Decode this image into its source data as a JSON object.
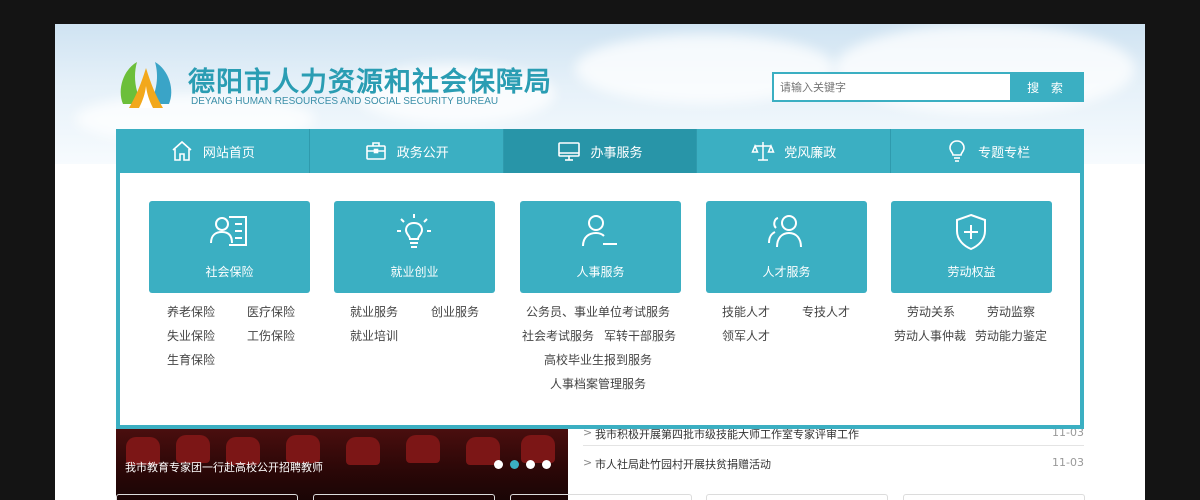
{
  "header": {
    "title_cn": "德阳市人力资源和社会保障局",
    "title_en": "DEYANG HUMAN RESOURCES AND SOCIAL SECURITY BUREAU",
    "logo_icon": "bureau-logo-icon"
  },
  "search": {
    "placeholder": "请输入关键字",
    "button_label": "搜 索"
  },
  "nav": {
    "items": [
      {
        "label": "网站首页",
        "icon": "home-icon"
      },
      {
        "label": "政务公开",
        "icon": "briefcase-icon"
      },
      {
        "label": "办事服务",
        "icon": "monitor-icon",
        "active": true
      },
      {
        "label": "党风廉政",
        "icon": "scales-icon"
      },
      {
        "label": "专题专栏",
        "icon": "lightbulb-icon"
      }
    ]
  },
  "services": [
    {
      "title": "社会保险",
      "icon": "id-card-icon",
      "links": [
        "养老保险",
        "医疗保险",
        "失业保险",
        "工伤保险",
        "生育保险"
      ]
    },
    {
      "title": "就业创业",
      "icon": "lightbulb-icon",
      "links": [
        "就业服务",
        "创业服务",
        "就业培训"
      ]
    },
    {
      "title": "人事服务",
      "icon": "user-minus-icon",
      "links": [
        "公务员、事业单位考试服务",
        "社会考试服务",
        "军转干部服务",
        "高校毕业生报到服务",
        "人事档案管理服务"
      ]
    },
    {
      "title": "人才服务",
      "icon": "users-icon",
      "links": [
        "技能人才",
        "专技人才",
        "领军人才"
      ]
    },
    {
      "title": "劳动权益",
      "icon": "shield-plus-icon",
      "links": [
        "劳动关系",
        "劳动监察",
        "劳动人事仲裁",
        "劳动能力鉴定"
      ]
    }
  ],
  "banner": {
    "caption": "我市教育专家团一行赴高校公开招聘教师",
    "slide_count": 4,
    "active_slide": 1
  },
  "news": [
    {
      "text": "我市积极开展第四批市级技能大师工作室专家评审工作",
      "date": "11-03"
    },
    {
      "text": "市人社局赴竹园村开展扶贫捐赠活动",
      "date": "11-03"
    }
  ],
  "colors": {
    "accent": "#3bafc2",
    "accent_dark": "#2895a8",
    "brand_text": "#2a9db3"
  }
}
